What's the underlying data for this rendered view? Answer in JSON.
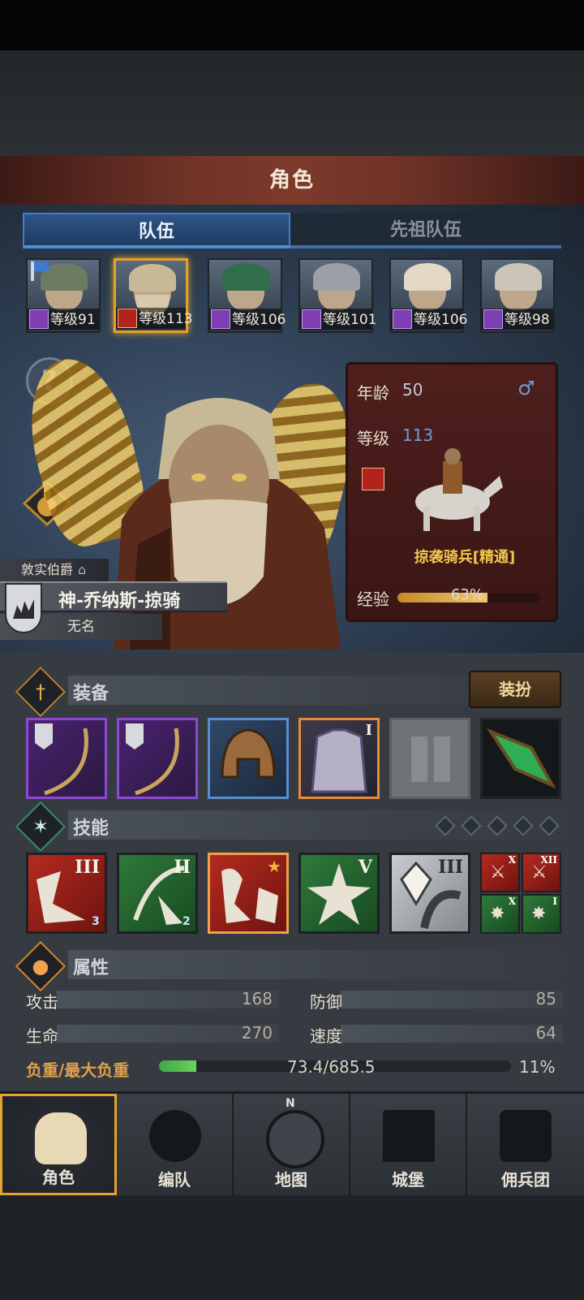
{
  "header": {
    "title": "角色"
  },
  "tabs": [
    {
      "label": "队伍",
      "active": true
    },
    {
      "label": "先祖队伍",
      "active": false
    }
  ],
  "roster": [
    {
      "level_text": "等级91",
      "hair": "#6a7b62",
      "cls": "purple",
      "flag": true
    },
    {
      "level_text": "等级113",
      "hair": "#c8b896",
      "cls": "red",
      "selected": true
    },
    {
      "level_text": "等级106",
      "hair": "#2f6e48",
      "cls": "purple"
    },
    {
      "level_text": "等级101",
      "hair": "#9aa0a6",
      "cls": "purple"
    },
    {
      "level_text": "等级106",
      "hair": "#e2d8c4",
      "cls": "purple"
    },
    {
      "level_text": "等级98",
      "hair": "#cbc5b8",
      "cls": "purple"
    }
  ],
  "character": {
    "rank": "敦实伯爵",
    "name": "神-乔纳斯-掠骑",
    "subtitle": "无名",
    "age_label": "年龄",
    "age": "50",
    "gender_symbol": "♂",
    "level_label": "等级",
    "level": "113",
    "unit_name": "掠袭骑兵[精通]",
    "exp_label": "经验",
    "exp_text": "63%",
    "exp_fraction": 0.63
  },
  "equipment": {
    "section_label": "装备",
    "dress_button": "装扮",
    "slots": [
      "bow",
      "bow",
      "helmet",
      "armor",
      "boots-empty",
      "amulet"
    ]
  },
  "skills": {
    "section_label": "技能",
    "main": [
      {
        "rank": "III",
        "color": "red",
        "badge": "3"
      },
      {
        "rank": "II",
        "color": "green",
        "badge": "2"
      },
      {
        "rank": "",
        "color": "red",
        "star": true
      },
      {
        "rank": "V",
        "color": "green"
      },
      {
        "rank": "III",
        "color": "gray"
      }
    ],
    "small": [
      {
        "rank": "X",
        "color": "red"
      },
      {
        "rank": "XII",
        "color": "red"
      },
      {
        "rank": "X",
        "color": "green"
      },
      {
        "rank": "I",
        "color": "green"
      }
    ]
  },
  "attributes": {
    "section_label": "属性",
    "attack_label": "攻击",
    "attack": "168",
    "defense_label": "防御",
    "defense": "85",
    "hp_label": "生命",
    "hp": "270",
    "speed_label": "速度",
    "speed": "64",
    "load_label": "负重/最大负重",
    "load_value": "73.4/685.5",
    "load_percent": "11%",
    "load_fraction": 0.107
  },
  "nav": [
    {
      "label": "角色",
      "active": true
    },
    {
      "label": "编队"
    },
    {
      "label": "地图"
    },
    {
      "label": "城堡"
    },
    {
      "label": "佣兵团"
    }
  ]
}
